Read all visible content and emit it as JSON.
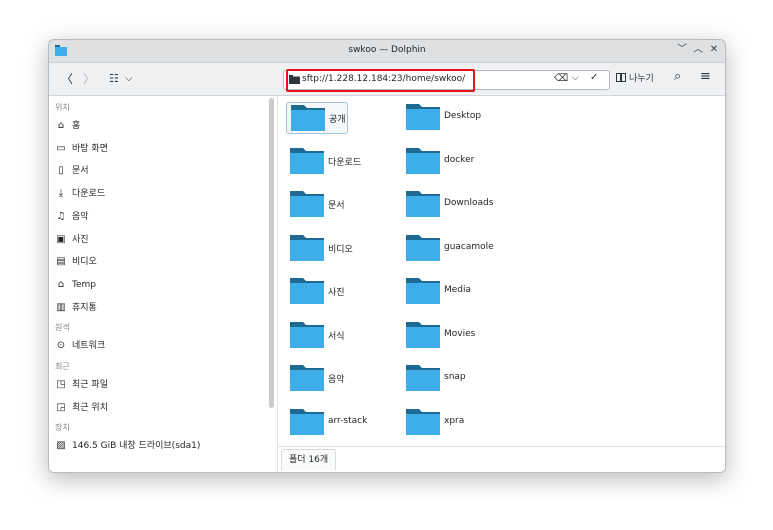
{
  "window": {
    "title": "swkoo — Dolphin",
    "controls": {
      "minimize": "﹀",
      "maximize": "︿",
      "close": "✕"
    }
  },
  "toolbar": {
    "back": "〈",
    "forward": "〉",
    "view_mode": "☷",
    "view_dropdown": "⌵",
    "location": "sftp://1.228.12.184:23/home/swkoo/",
    "clear": "⌫",
    "history_dropdown": "⌵",
    "confirm": "✓",
    "split_label": "나누기",
    "search": "⌕",
    "menu": "≡"
  },
  "sidebar": {
    "sections": [
      {
        "heading": "위치",
        "items": [
          {
            "icon": "home-icon",
            "glyph": "⌂",
            "label": "홈"
          },
          {
            "icon": "desktop-icon",
            "glyph": "▭",
            "label": "바탕 화면"
          },
          {
            "icon": "documents-icon",
            "glyph": "▯",
            "label": "문서"
          },
          {
            "icon": "downloads-icon",
            "glyph": "⤓",
            "label": "다운로드"
          },
          {
            "icon": "music-icon",
            "glyph": "♫",
            "label": "음악"
          },
          {
            "icon": "pictures-icon",
            "glyph": "▣",
            "label": "사진"
          },
          {
            "icon": "videos-icon",
            "glyph": "▤",
            "label": "비디오"
          },
          {
            "icon": "temp-icon",
            "glyph": "⌂",
            "label": "Temp"
          },
          {
            "icon": "trash-icon",
            "glyph": "▥",
            "label": "휴지통"
          }
        ]
      },
      {
        "heading": "원격",
        "items": [
          {
            "icon": "network-icon",
            "glyph": "⊙",
            "label": "네트워크"
          }
        ]
      },
      {
        "heading": "최근",
        "items": [
          {
            "icon": "recent-files-icon",
            "glyph": "◳",
            "label": "최근 파일"
          },
          {
            "icon": "recent-locations-icon",
            "glyph": "◲",
            "label": "최근 위치"
          }
        ]
      },
      {
        "heading": "장치",
        "items": [
          {
            "icon": "drive-icon",
            "glyph": "▨",
            "label": "146.5 GiB 내장 드라이브(sda1)"
          }
        ]
      }
    ]
  },
  "files": [
    {
      "name": "공개",
      "selected": true
    },
    {
      "name": "Desktop"
    },
    {
      "name": "다운로드"
    },
    {
      "name": "docker"
    },
    {
      "name": "문서"
    },
    {
      "name": "Downloads"
    },
    {
      "name": "비디오"
    },
    {
      "name": "guacamole"
    },
    {
      "name": "사진"
    },
    {
      "name": "Media"
    },
    {
      "name": "서식"
    },
    {
      "name": "Movies"
    },
    {
      "name": "음악"
    },
    {
      "name": "snap"
    },
    {
      "name": "arr-stack"
    },
    {
      "name": "xpra"
    }
  ],
  "status": {
    "folder_count": "폴더 16개"
  },
  "colors": {
    "folder_body": "#3daee9",
    "folder_tab": "#1d6a93",
    "highlight": "#e5141c",
    "selection": "#a3c4e3"
  }
}
